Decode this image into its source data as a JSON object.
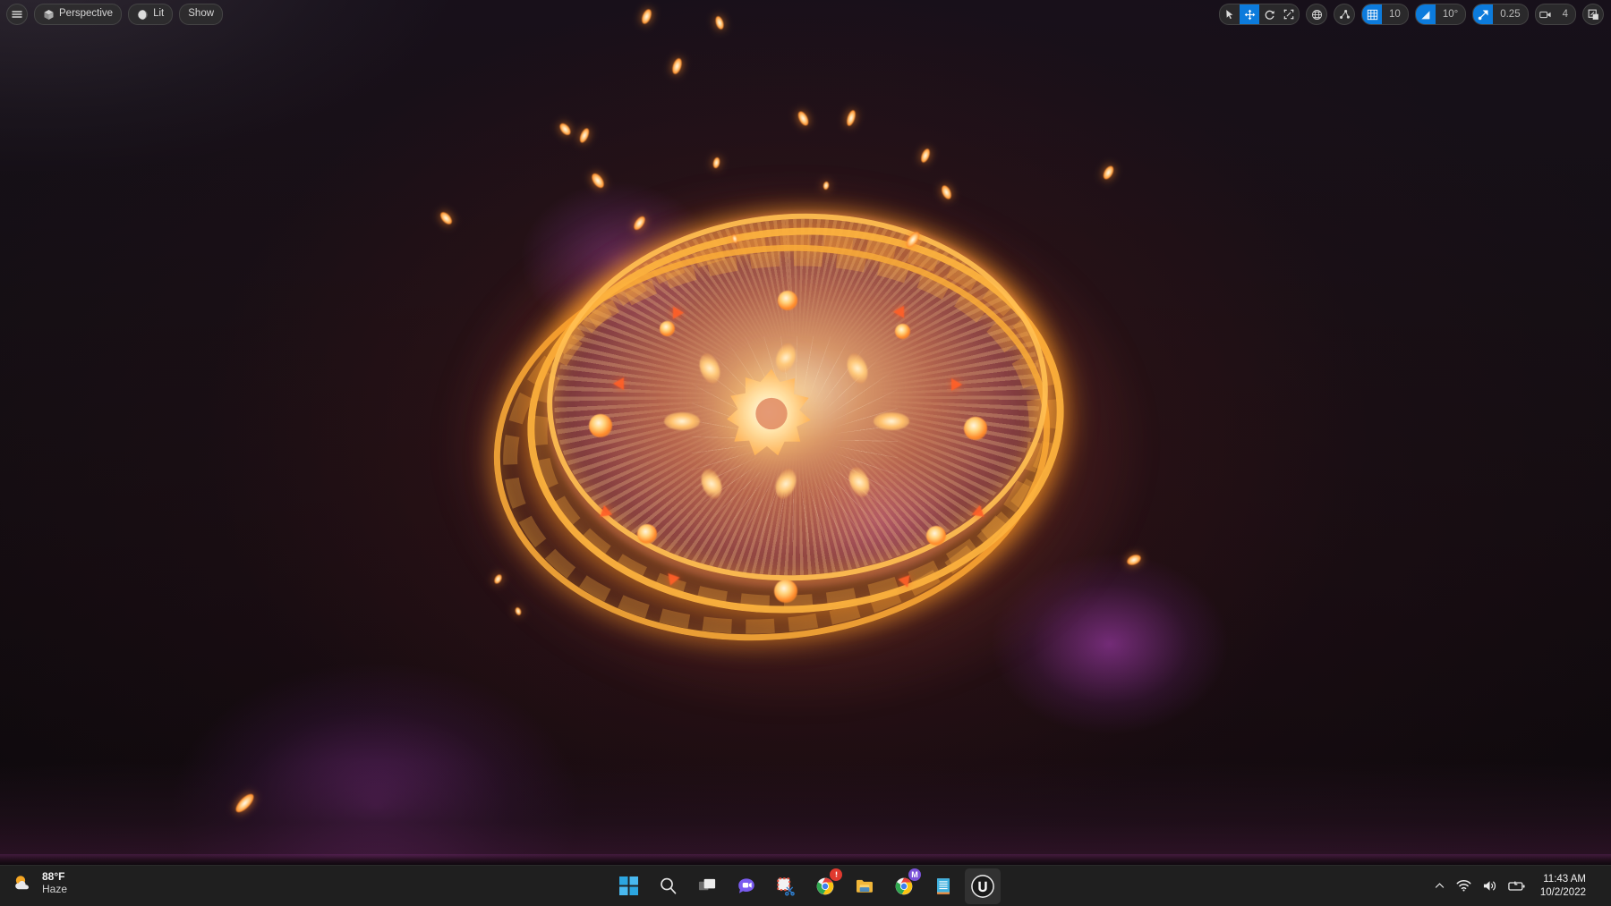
{
  "viewport": {
    "toolbar_left": [
      {
        "name": "menu",
        "icon": "hamburger-icon",
        "label": ""
      },
      {
        "name": "view-mode",
        "icon": "cube-icon",
        "label": "Perspective"
      },
      {
        "name": "lighting-mode",
        "icon": "sphere-icon",
        "label": "Lit"
      },
      {
        "name": "show-flags",
        "icon": "",
        "label": "Show"
      }
    ],
    "toolbar_right": {
      "transform_tools": [
        {
          "name": "select-tool",
          "icon": "cursor-arrow-icon",
          "active": false
        },
        {
          "name": "move-tool",
          "icon": "move-arrows-icon",
          "active": true
        },
        {
          "name": "rotate-tool",
          "icon": "rotate-icon",
          "active": false
        },
        {
          "name": "scale-tool",
          "icon": "scale-icon",
          "active": false
        }
      ],
      "coordinate_system": {
        "name": "world-coordinates",
        "icon": "globe-icon"
      },
      "surface_snap": {
        "name": "surface-snapping",
        "icon": "surface-snap-icon"
      },
      "grid_snap": {
        "name": "grid-snap",
        "icon": "grid-icon",
        "value": "10",
        "active": true
      },
      "angle_snap": {
        "name": "angle-snap",
        "icon": "angle-icon",
        "value": "10°",
        "active": true
      },
      "scale_snap": {
        "name": "scale-snap",
        "icon": "diagonal-arrow-icon",
        "value": "0.25",
        "active": true
      },
      "camera_speed": {
        "name": "camera-speed",
        "icon": "camera-icon",
        "value": "4"
      },
      "maximize": {
        "name": "maximize-viewport",
        "icon": "maximize-icon"
      }
    },
    "scene": {
      "description": "Magic circle portal VFX with concentric glowing rings, radial burst, nine-pointed star core and ember sparks",
      "colors": {
        "ring": "#f8aa38",
        "core": "#fff1cf",
        "ember": "#ff8a25",
        "haze_purple": "#b03ec4",
        "background": "#130d0f"
      }
    }
  },
  "taskbar": {
    "weather": {
      "icon": "sun-cloud-icon",
      "temperature": "88°F",
      "condition": "Haze"
    },
    "apps": [
      {
        "name": "start-button",
        "icon": "windows-logo-icon",
        "label": "Start",
        "active": false,
        "running": false
      },
      {
        "name": "search-button",
        "icon": "search-icon",
        "label": "Search",
        "active": false,
        "running": false
      },
      {
        "name": "task-view-button",
        "icon": "task-view-icon",
        "label": "Task View",
        "active": false,
        "running": false
      },
      {
        "name": "chat-button",
        "icon": "chat-video-icon",
        "label": "Chat",
        "active": false,
        "running": false
      },
      {
        "name": "snipping-tool-button",
        "icon": "snipping-tool-icon",
        "label": "Snipping Tool",
        "active": false,
        "running": false
      },
      {
        "name": "chrome-button",
        "icon": "chrome-icon",
        "label": "Google Chrome",
        "active": false,
        "running": true,
        "badge": ""
      },
      {
        "name": "file-explorer-button",
        "icon": "folder-icon",
        "label": "File Explorer",
        "active": false,
        "running": true
      },
      {
        "name": "chrome-mail-button",
        "icon": "chrome-icon",
        "label": "Google Chrome",
        "active": false,
        "running": true,
        "badge": "M"
      },
      {
        "name": "notepad-button",
        "icon": "notepad-icon",
        "label": "Notepad",
        "active": false,
        "running": true
      },
      {
        "name": "unreal-engine-button",
        "icon": "unreal-engine-icon",
        "label": "Unreal Engine",
        "active": true,
        "running": true
      }
    ],
    "tray": {
      "overflow": {
        "name": "tray-overflow",
        "icon": "chevron-up-icon"
      },
      "network": {
        "name": "network-status",
        "icon": "wifi-icon"
      },
      "volume": {
        "name": "volume-status",
        "icon": "speaker-icon"
      },
      "battery": {
        "name": "battery-status",
        "icon": "battery-charging-icon"
      },
      "clock": {
        "time": "11:43 AM",
        "date": "10/2/2022"
      },
      "show_desktop": {
        "name": "show-desktop",
        "icon": "show-desktop-icon"
      }
    }
  }
}
